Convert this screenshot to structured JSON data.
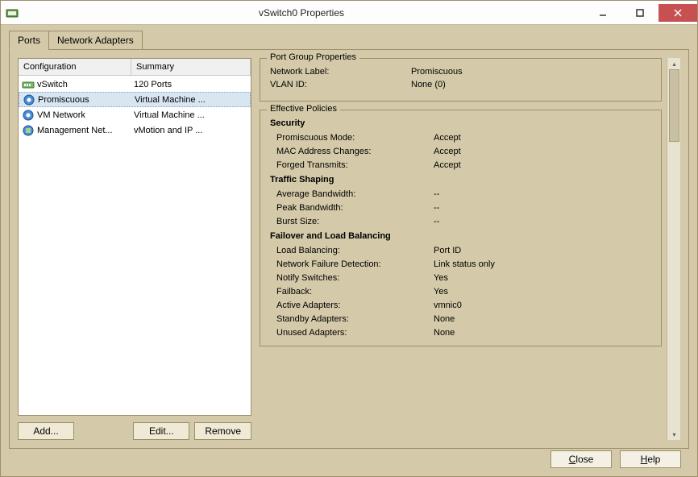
{
  "titlebar": {
    "title": "vSwitch0 Properties"
  },
  "tabs": {
    "ports": "Ports",
    "adapters": "Network Adapters"
  },
  "list": {
    "headers": {
      "config": "Configuration",
      "summary": "Summary"
    },
    "rows": [
      {
        "config": "vSwitch",
        "summary": "120 Ports"
      },
      {
        "config": "Promiscuous",
        "summary": "Virtual Machine ..."
      },
      {
        "config": "VM Network",
        "summary": "Virtual Machine ..."
      },
      {
        "config": "Management Net...",
        "summary": "vMotion and IP ..."
      }
    ]
  },
  "buttons": {
    "add": "Add...",
    "edit": "Edit...",
    "remove": "Remove",
    "close": "Close",
    "help": "Help"
  },
  "portgroup": {
    "legend": "Port Group Properties",
    "network_label_label": "Network Label:",
    "network_label_value": "Promiscuous",
    "vlan_label": "VLAN ID:",
    "vlan_value": "None (0)"
  },
  "policies": {
    "legend": "Effective Policies",
    "security": {
      "heading": "Security",
      "promiscuous_label": "Promiscuous Mode:",
      "promiscuous_value": "Accept",
      "mac_label": "MAC Address Changes:",
      "mac_value": "Accept",
      "forged_label": "Forged Transmits:",
      "forged_value": "Accept"
    },
    "shaping": {
      "heading": "Traffic Shaping",
      "avg_label": "Average Bandwidth:",
      "avg_value": "--",
      "peak_label": "Peak Bandwidth:",
      "peak_value": "--",
      "burst_label": "Burst Size:",
      "burst_value": "--"
    },
    "failover": {
      "heading": "Failover and Load Balancing",
      "lb_label": "Load Balancing:",
      "lb_value": "Port ID",
      "nfd_label": "Network Failure Detection:",
      "nfd_value": "Link status only",
      "notify_label": "Notify Switches:",
      "notify_value": "Yes",
      "failback_label": "Failback:",
      "failback_value": "Yes",
      "active_label": "Active Adapters:",
      "active_value": "vmnic0",
      "standby_label": "Standby Adapters:",
      "standby_value": "None",
      "unused_label": "Unused Adapters:",
      "unused_value": "None"
    }
  }
}
